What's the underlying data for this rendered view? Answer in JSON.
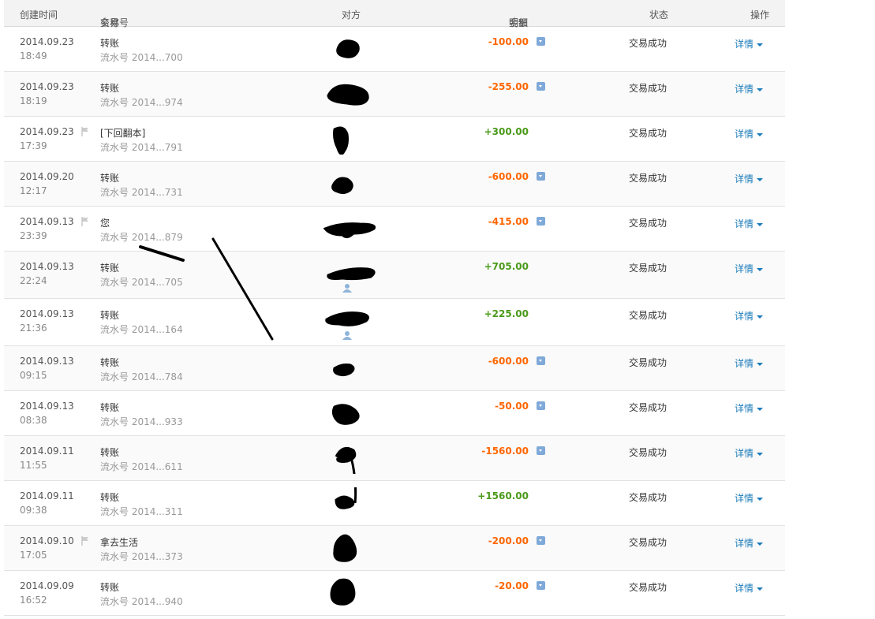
{
  "header": {
    "created_time": "创建时间",
    "name": "名称",
    "trade_no": "交易号",
    "party": "对方",
    "amount": "金额",
    "detail": "明细",
    "status": "状态",
    "ops": "操作"
  },
  "rows": [
    {
      "date": "2014.09.23",
      "time": "18:49",
      "name": "转账",
      "serial": "流水号 2014...700",
      "amount": "-100.00",
      "sign": "neg",
      "status": "交易成功",
      "op": "详情",
      "flag": false,
      "user": false
    },
    {
      "date": "2014.09.23",
      "time": "18:19",
      "name": "转账",
      "serial": "流水号 2014...974",
      "amount": "-255.00",
      "sign": "neg",
      "status": "交易成功",
      "op": "详情",
      "flag": false,
      "user": false
    },
    {
      "date": "2014.09.23",
      "time": "17:39",
      "name": "[下回翻本]",
      "serial": "流水号 2014...791",
      "amount": "+300.00",
      "sign": "pos",
      "status": "交易成功",
      "op": "详情",
      "flag": true,
      "user": false
    },
    {
      "date": "2014.09.20",
      "time": "12:17",
      "name": "转账",
      "serial": "流水号 2014...731",
      "amount": "-600.00",
      "sign": "neg",
      "status": "交易成功",
      "op": "详情",
      "flag": false,
      "user": false
    },
    {
      "date": "2014.09.13",
      "time": "23:39",
      "name": "您",
      "serial": "流水号 2014...879",
      "amount": "-415.00",
      "sign": "neg",
      "status": "交易成功",
      "op": "详情",
      "flag": true,
      "user": false
    },
    {
      "date": "2014.09.13",
      "time": "22:24",
      "name": "转账",
      "serial": "流水号 2014...705",
      "amount": "+705.00",
      "sign": "pos",
      "status": "交易成功",
      "op": "详情",
      "flag": false,
      "user": true
    },
    {
      "date": "2014.09.13",
      "time": "21:36",
      "name": "转账",
      "serial": "流水号 2014...164",
      "amount": "+225.00",
      "sign": "pos",
      "status": "交易成功",
      "op": "详情",
      "flag": false,
      "user": true
    },
    {
      "date": "2014.09.13",
      "time": "09:15",
      "name": "转账",
      "serial": "流水号 2014...784",
      "amount": "-600.00",
      "sign": "neg",
      "status": "交易成功",
      "op": "详情",
      "flag": false,
      "user": false
    },
    {
      "date": "2014.09.13",
      "time": "08:38",
      "name": "转账",
      "serial": "流水号 2014...933",
      "amount": "-50.00",
      "sign": "neg",
      "status": "交易成功",
      "op": "详情",
      "flag": false,
      "user": false
    },
    {
      "date": "2014.09.11",
      "time": "11:55",
      "name": "转账",
      "serial": "流水号 2014...611",
      "amount": "-1560.00",
      "sign": "neg",
      "status": "交易成功",
      "op": "详情",
      "flag": false,
      "user": false
    },
    {
      "date": "2014.09.11",
      "time": "09:38",
      "name": "转账",
      "serial": "流水号 2014...311",
      "amount": "+1560.00",
      "sign": "pos",
      "status": "交易成功",
      "op": "详情",
      "flag": false,
      "user": false
    },
    {
      "date": "2014.09.10",
      "time": "17:05",
      "name": "拿去生活",
      "serial": "流水号 2014...373",
      "amount": "-200.00",
      "sign": "neg",
      "status": "交易成功",
      "op": "详情",
      "flag": true,
      "user": false
    },
    {
      "date": "2014.09.09",
      "time": "16:52",
      "name": "转账",
      "serial": "流水号 2014...940",
      "amount": "-20.00",
      "sign": "neg",
      "status": "交易成功",
      "op": "详情",
      "flag": false,
      "user": false
    }
  ]
}
